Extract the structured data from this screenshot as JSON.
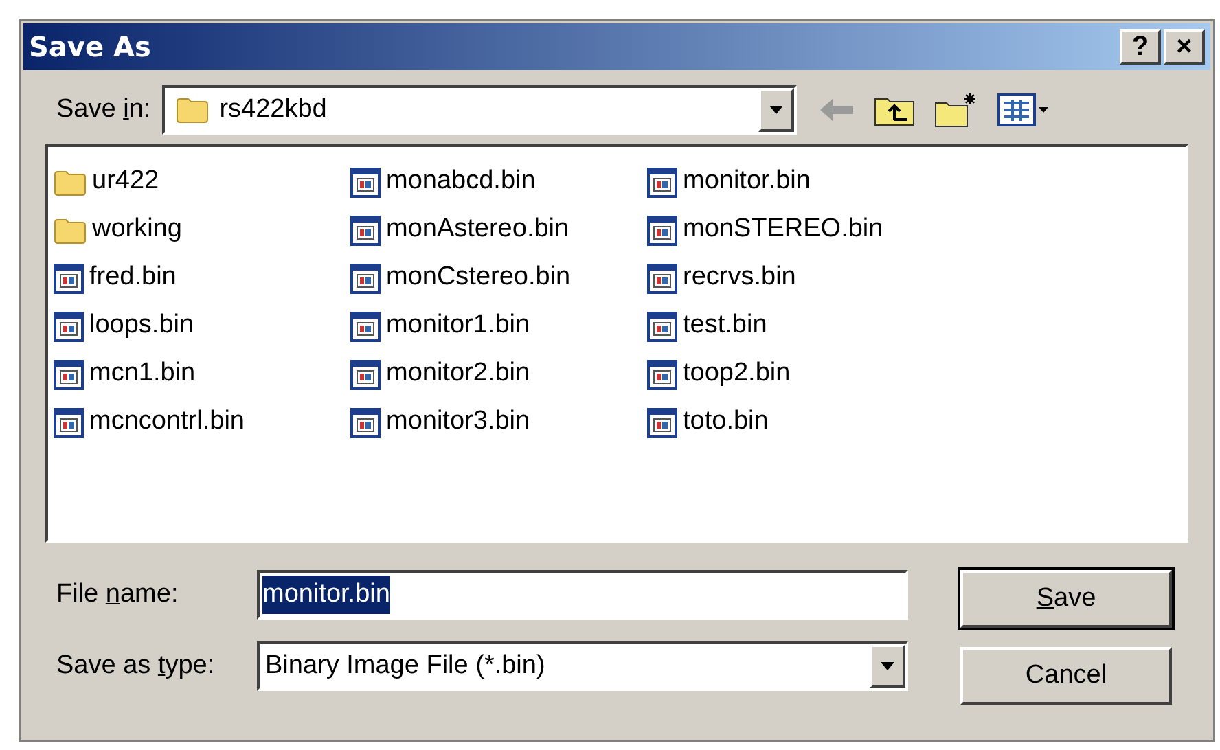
{
  "window": {
    "title": "Save As",
    "buttons": [
      "?",
      "×"
    ]
  },
  "save_in": {
    "label": [
      {
        "text": "Save ",
        "underlined": false
      },
      {
        "text": "i",
        "underlined": true
      },
      {
        "text": "n:",
        "underlined": false
      }
    ],
    "value": "rs422kbd"
  },
  "files": [
    [
      {
        "name": "ur422",
        "kind": "folder"
      },
      {
        "name": "working",
        "kind": "folder"
      },
      {
        "name": "fred.bin",
        "kind": "file"
      },
      {
        "name": "loops.bin",
        "kind": "file"
      },
      {
        "name": "mcn1.bin",
        "kind": "file"
      },
      {
        "name": "mcncontrl.bin",
        "kind": "file"
      }
    ],
    [
      {
        "name": "monabcd.bin",
        "kind": "file"
      },
      {
        "name": "monAstereo.bin",
        "kind": "file"
      },
      {
        "name": "monCstereo.bin",
        "kind": "file"
      },
      {
        "name": "monitor1.bin",
        "kind": "file"
      },
      {
        "name": "monitor2.bin",
        "kind": "file"
      },
      {
        "name": "monitor3.bin",
        "kind": "file"
      }
    ],
    [
      {
        "name": "monitor.bin",
        "kind": "file"
      },
      {
        "name": "monSTEREO.bin",
        "kind": "file"
      },
      {
        "name": "recrvs.bin",
        "kind": "file"
      },
      {
        "name": "test.bin",
        "kind": "file"
      },
      {
        "name": "toop2.bin",
        "kind": "file"
      },
      {
        "name": "toto.bin",
        "kind": "file"
      }
    ]
  ],
  "file_name": {
    "label": [
      {
        "text": "File ",
        "underlined": false
      },
      {
        "text": "n",
        "underlined": true
      },
      {
        "text": "ame:",
        "underlined": false
      }
    ],
    "value": "monitor.bin",
    "selected": true
  },
  "save_as_type": {
    "label": [
      {
        "text": "Save as ",
        "underlined": false
      },
      {
        "text": "t",
        "underlined": true
      },
      {
        "text": "ype:",
        "underlined": false
      }
    ],
    "value": "Binary Image File (*.bin)"
  },
  "buttons": [
    {
      "label": [
        {
          "text": "S",
          "underlined": true
        },
        {
          "text": "ave",
          "underlined": false
        }
      ],
      "default": true
    },
    {
      "label": [
        {
          "text": "Cancel",
          "underlined": false
        }
      ],
      "default": false
    }
  ]
}
